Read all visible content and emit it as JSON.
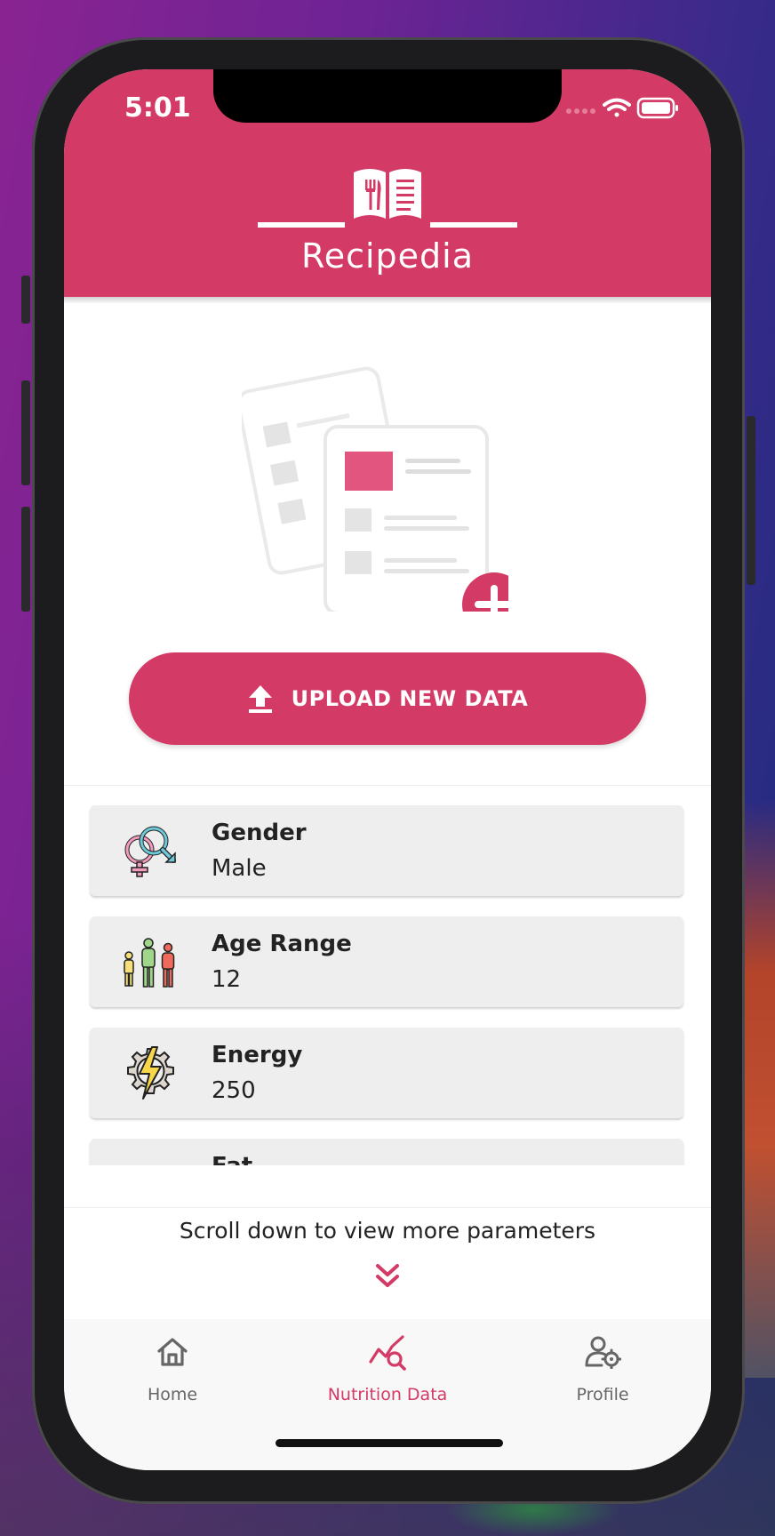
{
  "status_bar": {
    "time": "5:01"
  },
  "app": {
    "title": "Recipedia"
  },
  "upload": {
    "label": "UPLOAD NEW DATA"
  },
  "parameters": [
    {
      "title": "Gender",
      "value": "Male",
      "icon": "gender-icon"
    },
    {
      "title": "Age Range",
      "value": "12",
      "icon": "age-group-icon"
    },
    {
      "title": "Energy",
      "value": "250",
      "icon": "energy-icon"
    },
    {
      "title": "Fat",
      "value": "",
      "icon": "fat-icon"
    }
  ],
  "scroll_hint": "Scroll down to view more parameters",
  "tabs": [
    {
      "label": "Home",
      "icon": "home-icon",
      "active": false
    },
    {
      "label": "Nutrition Data",
      "icon": "nutrition-chart-icon",
      "active": true
    },
    {
      "label": "Profile",
      "icon": "profile-settings-icon",
      "active": false
    }
  ],
  "colors": {
    "accent": "#d43a66",
    "card": "#eeeeee",
    "tabbar": "#f8f8f8"
  }
}
